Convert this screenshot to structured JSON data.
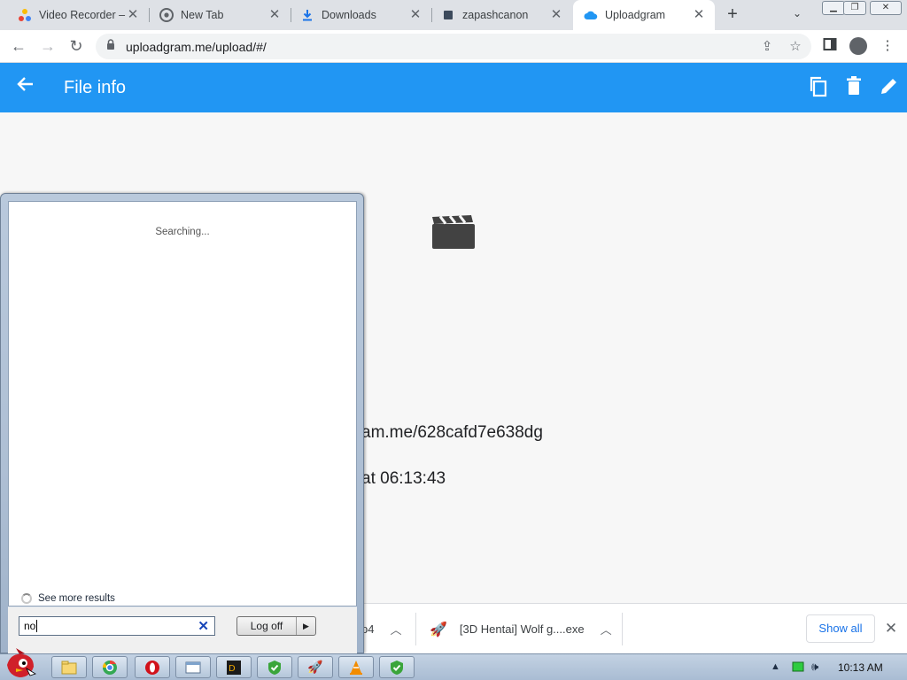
{
  "browser": {
    "tabs": [
      {
        "title": "Video Recorder – ",
        "icon": "video-recorder-favicon",
        "active": false
      },
      {
        "title": "New Tab",
        "icon": "chrome-favicon",
        "active": false
      },
      {
        "title": "Downloads",
        "icon": "download-favicon",
        "active": false
      },
      {
        "title": "zapashcanon",
        "icon": "page-favicon",
        "active": false
      },
      {
        "title": "Uploadgram",
        "icon": "cloud-favicon",
        "active": true
      }
    ],
    "url": "uploadgram.me/upload/#/",
    "accent": "#2196f3"
  },
  "appbar": {
    "title": "File info",
    "actions": [
      "copy-icon",
      "delete-icon",
      "edit-icon"
    ]
  },
  "content": {
    "link_text": "am.me/628cafd7e638dg",
    "date_text": "at 06:13:43"
  },
  "shelf": {
    "item1_name": "p4",
    "item2_name": "[3D Hentai] Wolf g....exe",
    "show_all": "Show all"
  },
  "startmenu": {
    "status": "Searching...",
    "see_more": "See more results",
    "search_value": "no",
    "logoff": "Log off"
  },
  "taskbar": {
    "clock": "10:13 AM",
    "apps": [
      "explorer",
      "chrome",
      "opera",
      "window",
      "dc",
      "shield",
      "rocket",
      "vlc",
      "shield2"
    ]
  }
}
